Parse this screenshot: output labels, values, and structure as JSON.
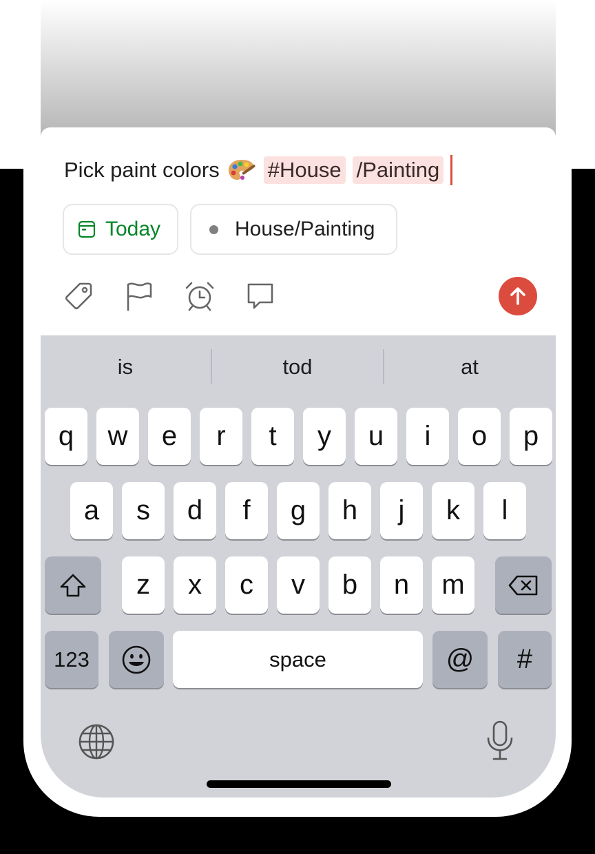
{
  "task": {
    "text": "Pick paint colors",
    "emoji": "🎨",
    "label_chip": "#House",
    "project_chip": "/Painting"
  },
  "pills": {
    "date": "Today",
    "project": "House/Painting"
  },
  "toolbar": {
    "icons": [
      "tag-icon",
      "flag-icon",
      "alarm-clock-icon",
      "comment-icon"
    ],
    "send_icon": "arrow-up-icon"
  },
  "keyboard": {
    "suggestions": [
      "is",
      "tod",
      "at"
    ],
    "row1": [
      "q",
      "w",
      "e",
      "r",
      "t",
      "y",
      "u",
      "i",
      "o",
      "p"
    ],
    "row2": [
      "a",
      "s",
      "d",
      "f",
      "g",
      "h",
      "j",
      "k",
      "l"
    ],
    "row3": [
      "z",
      "x",
      "c",
      "v",
      "b",
      "n",
      "m"
    ],
    "numbers_key": "123",
    "space_key": "space",
    "at_key": "@",
    "hash_key": "#"
  },
  "colors": {
    "accent": "#dc4c3e",
    "today_green": "#058527",
    "chip_bg": "#fbe1df",
    "keyboard_bg": "#d1d3d9",
    "dark_key": "#acb0bb"
  }
}
